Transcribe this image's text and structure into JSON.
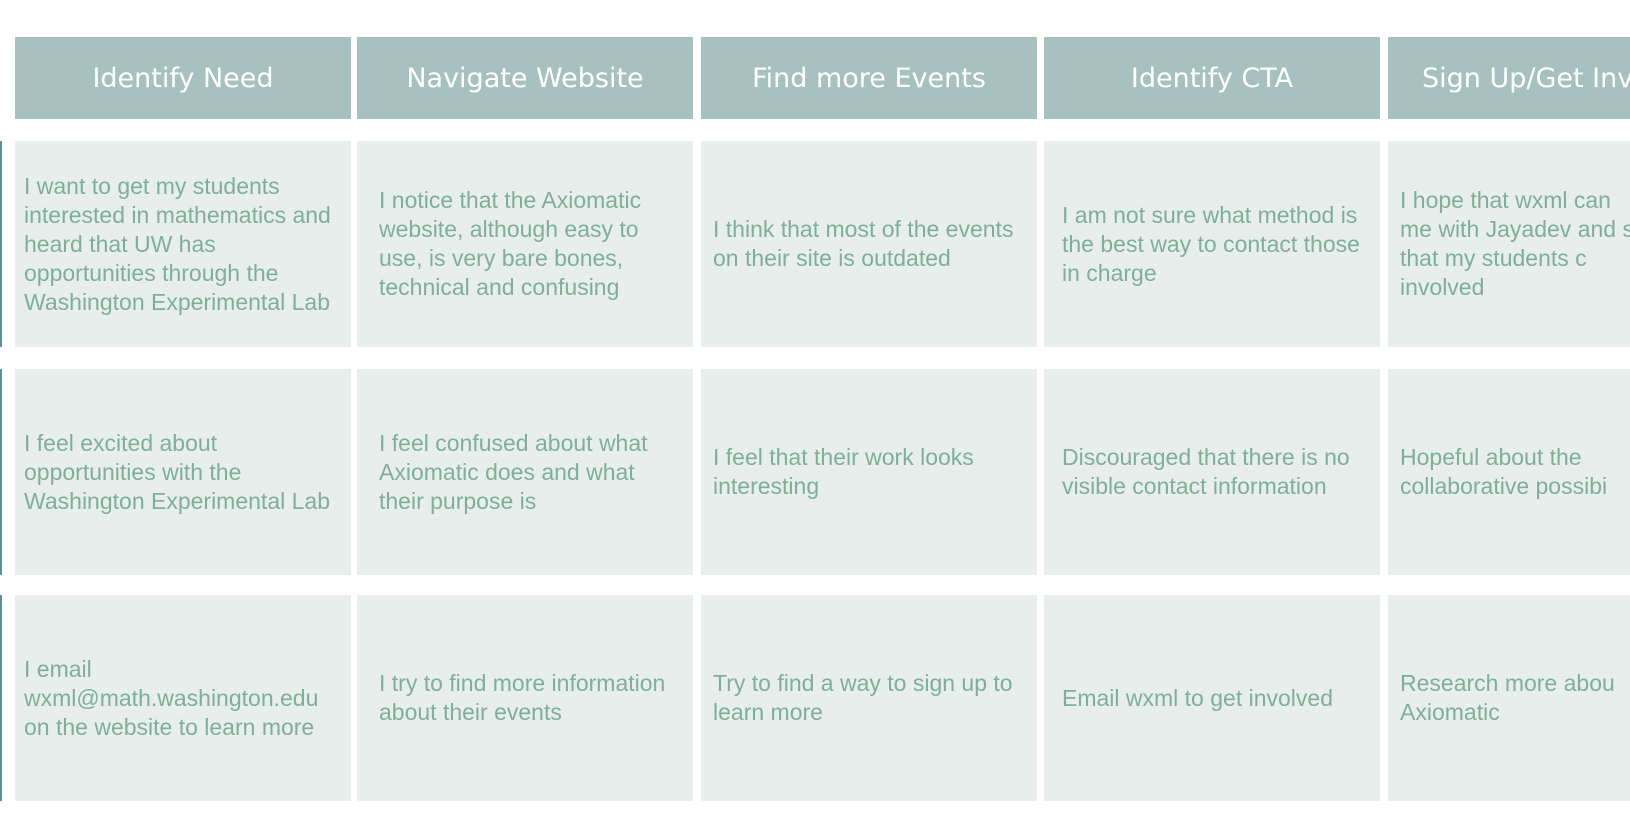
{
  "colors": {
    "header_bg": "#a6c1be",
    "header_text": "#ffffff",
    "cell_bg": "#e7eeeb",
    "cell_text": "#7faf9a",
    "edge_line": "#5d8f9b"
  },
  "stages": [
    "Identify Need",
    "Navigate Website",
    "Find more Events",
    "Identify CTA",
    "Sign Up/Get Inv"
  ],
  "rows": [
    {
      "cells": [
        "I want to get my students interested in mathematics and heard that UW has opportunities through the Washington Experimental Lab",
        "I notice that the Axiomatic website, although easy to use, is very bare bones, technical and confusing",
        "I think that most of the events on their site is outdated",
        "I am not sure what method is the best way to contact those in charge",
        "I hope that wxml can me with Jayadev and so that my students c involved"
      ]
    },
    {
      "cells": [
        "I feel excited about opportunities with the Washington Experimental Lab",
        "I feel confused about what Axiomatic does and what their purpose is",
        "I feel that their work looks interesting",
        "Discouraged that there is no visible contact information",
        "Hopeful about the collaborative possibi"
      ]
    },
    {
      "cells": [
        "I email wxml@math.washington.edu on the website to learn more",
        "I try to find more information about their events",
        "Try to find a way to sign up to learn more",
        "Email wxml to get involved",
        "Research more abou Axiomatic"
      ]
    }
  ]
}
